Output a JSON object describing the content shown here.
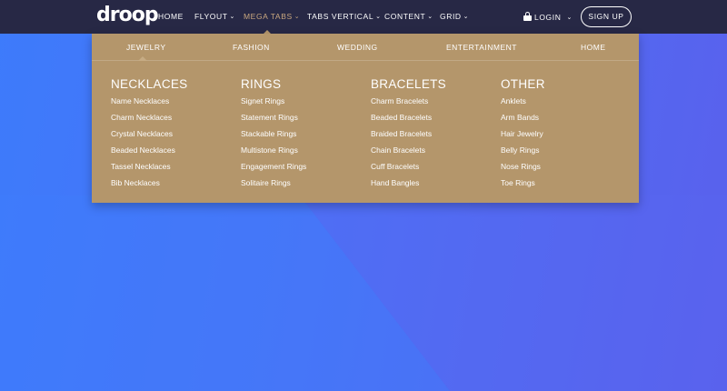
{
  "brand": {
    "logo_text": "droop"
  },
  "nav": {
    "items": [
      {
        "label": "HOME",
        "caret": false
      },
      {
        "label": "FLYOUT",
        "caret": true
      },
      {
        "label": "MEGA TABS",
        "caret": true,
        "active": true
      },
      {
        "label": "TABS VERTICAL",
        "caret": true
      },
      {
        "label": "CONTENT",
        "caret": true
      },
      {
        "label": "GRID",
        "caret": true
      }
    ],
    "login_label": "LOGIN",
    "signup_label": "SIGN UP"
  },
  "mega": {
    "tabs": [
      "JEWELRY",
      "FASHION",
      "WEDDING",
      "ENTERTAINMENT",
      "HOME"
    ],
    "active_tab": "JEWELRY",
    "columns": [
      {
        "title": "NECKLACES",
        "links": [
          "Name Necklaces",
          "Charm Necklaces",
          "Crystal Necklaces",
          "Beaded Necklaces",
          "Tassel Necklaces",
          "Bib Necklaces"
        ]
      },
      {
        "title": "RINGS",
        "links": [
          "Signet Rings",
          "Statement Rings",
          "Stackable Rings",
          "Multistone Rings",
          "Engagement Rings",
          "Solitaire Rings"
        ]
      },
      {
        "title": "BRACELETS",
        "links": [
          "Charm Bracelets",
          "Beaded Bracelets",
          "Braided Bracelets",
          "Chain Bracelets",
          "Cuff Bracelets",
          "Hand Bangles"
        ]
      },
      {
        "title": "OTHER",
        "links": [
          "Anklets",
          "Arm Bands",
          "Hair Jewelry",
          "Belly Rings",
          "Nose Rings",
          "Toe Rings"
        ]
      }
    ]
  },
  "colors": {
    "navbar": "#272845",
    "accent": "#c9a77f",
    "mega_panel": "#b4966b",
    "background_start": "#3d7bfb",
    "background_end": "#5a60ec"
  }
}
